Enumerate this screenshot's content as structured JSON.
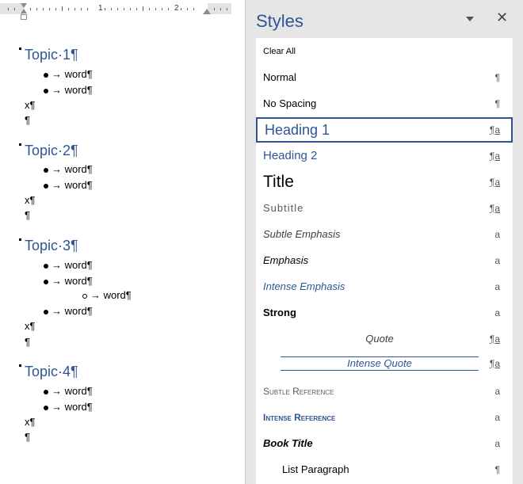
{
  "document": {
    "ruler": {
      "numbers": [
        "1",
        "2"
      ]
    },
    "sections": [
      {
        "heading": "Topic·1¶",
        "lines": [
          {
            "text": "→ word¶",
            "level": 1
          },
          {
            "text": "→ word¶",
            "level": 1
          }
        ],
        "after": [
          "x¶",
          "¶"
        ]
      },
      {
        "heading": "Topic·2¶",
        "lines": [
          {
            "text": "→ word¶",
            "level": 1
          },
          {
            "text": "→ word¶",
            "level": 1
          }
        ],
        "after": [
          "x¶",
          "¶"
        ]
      },
      {
        "heading": "Topic·3¶",
        "lines": [
          {
            "text": "→ word¶",
            "level": 1
          },
          {
            "text": "→ word¶",
            "level": 1
          },
          {
            "text": "→ word¶",
            "level": 2
          },
          {
            "text": "→ word¶",
            "level": 1
          }
        ],
        "after": [
          "x¶",
          "¶"
        ]
      },
      {
        "heading": "Topic·4¶",
        "lines": [
          {
            "text": "→ word¶",
            "level": 1
          },
          {
            "text": "→ word¶",
            "level": 1
          }
        ],
        "after": [
          "x¶",
          "¶"
        ]
      }
    ]
  },
  "styles_pane": {
    "title": "Styles",
    "accent_color": "#2f5496",
    "items": [
      {
        "label": "Clear All",
        "marker": ""
      },
      {
        "label": "Normal",
        "marker": "¶"
      },
      {
        "label": "No Spacing",
        "marker": "¶"
      },
      {
        "label": "Heading 1",
        "marker": "¶a",
        "selected": true
      },
      {
        "label": "Heading 2",
        "marker": "¶a"
      },
      {
        "label": "Title",
        "marker": "¶a"
      },
      {
        "label": "Subtitle",
        "marker": "¶a"
      },
      {
        "label": "Subtle Emphasis",
        "marker": "a"
      },
      {
        "label": "Emphasis",
        "marker": "a"
      },
      {
        "label": "Intense Emphasis",
        "marker": "a"
      },
      {
        "label": "Strong",
        "marker": "a"
      },
      {
        "label": "Quote",
        "marker": "¶a"
      },
      {
        "label": "Intense Quote",
        "marker": "¶a"
      },
      {
        "label": "Subtle Reference",
        "marker": "a"
      },
      {
        "label": "Intense Reference",
        "marker": "a"
      },
      {
        "label": "Book Title",
        "marker": "a"
      },
      {
        "label": "List Paragraph",
        "marker": "¶"
      }
    ]
  }
}
